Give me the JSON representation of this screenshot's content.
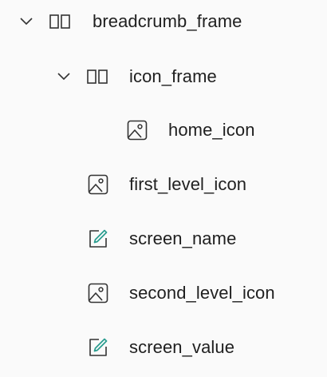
{
  "tree": {
    "nodes": [
      {
        "label": "breadcrumb_frame",
        "icon": "frame-icon",
        "expanded": true
      },
      {
        "label": "icon_frame",
        "icon": "frame-icon",
        "expanded": true
      },
      {
        "label": "home_icon",
        "icon": "image-icon"
      },
      {
        "label": "first_level_icon",
        "icon": "image-icon"
      },
      {
        "label": "screen_name",
        "icon": "edit-text-icon"
      },
      {
        "label": "second_level_icon",
        "icon": "image-icon"
      },
      {
        "label": "screen_value",
        "icon": "edit-text-icon"
      }
    ]
  },
  "colors": {
    "text": "#1f1f1f",
    "icon_stroke": "#333333",
    "edit_accent": "#2a9d8f"
  }
}
